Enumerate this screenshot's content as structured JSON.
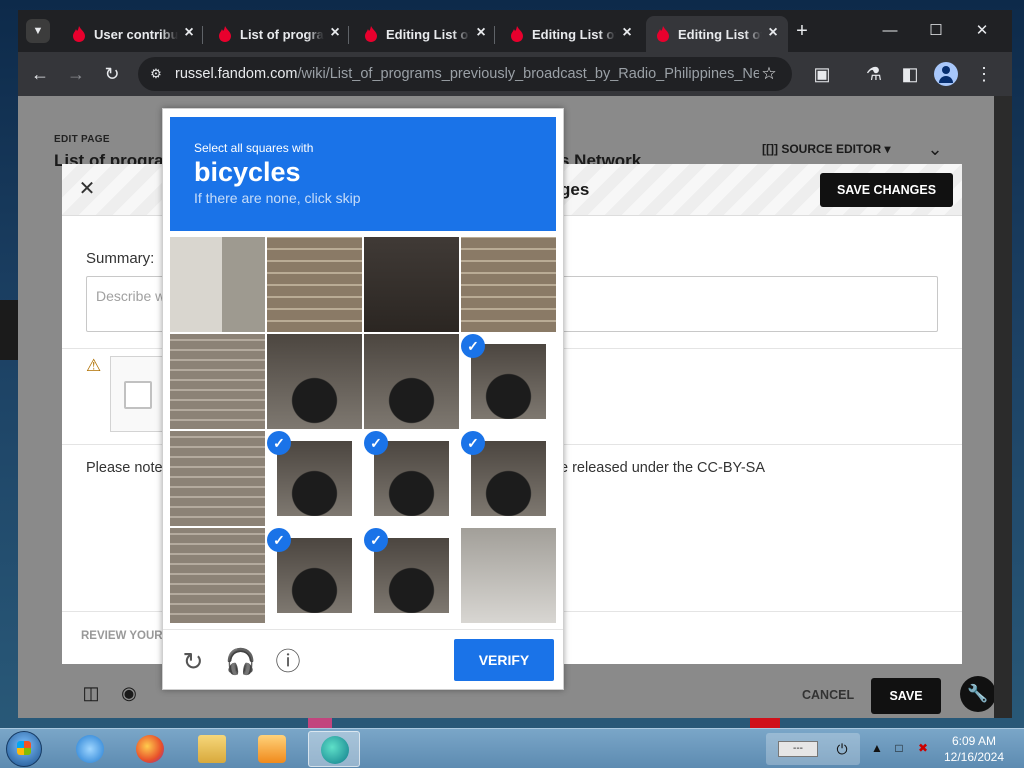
{
  "browser": {
    "tabs": [
      {
        "label": "User contributions",
        "active": false
      },
      {
        "label": "List of programs",
        "active": false
      },
      {
        "label": "Editing List of",
        "active": false
      },
      {
        "label": "Editing List of",
        "active": false
      },
      {
        "label": "Editing List of",
        "active": true
      }
    ],
    "address": {
      "host": "russel.fandom.com",
      "path": "/wiki/List_of_programs_previously_broadcast_by_Radio_Philippines_Netwo..."
    }
  },
  "editor": {
    "edit_page_label": "EDIT PAGE",
    "page_title_left": "List of progra",
    "page_title_right": "s Network",
    "source_editor": "[[]] SOURCE EDITOR ▾",
    "cancel": "CANCEL",
    "save": "SAVE"
  },
  "save_dialog": {
    "title_tail": "ges",
    "save_changes": "SAVE CHANGES",
    "summary_label": "Summary:",
    "summary_placeholder": "Describe w",
    "note_left": "Please note",
    "note_right": "e released under the CC-BY-SA",
    "review": "REVIEW YOUR"
  },
  "captcha": {
    "line1": "Select all squares with",
    "line2": "bicycles",
    "line3": "If there are none, click skip",
    "verify": "VERIFY",
    "tiles": [
      {
        "kind": "wall",
        "selected": false
      },
      {
        "kind": "brick",
        "selected": false
      },
      {
        "kind": "dark",
        "selected": false
      },
      {
        "kind": "brick",
        "selected": false
      },
      {
        "kind": "pillar",
        "selected": false
      },
      {
        "kind": "bike",
        "selected": false
      },
      {
        "kind": "bike",
        "selected": false
      },
      {
        "kind": "bike",
        "selected": true
      },
      {
        "kind": "pillar",
        "selected": false
      },
      {
        "kind": "bike",
        "selected": true
      },
      {
        "kind": "bike",
        "selected": true
      },
      {
        "kind": "bike",
        "selected": true
      },
      {
        "kind": "pillar",
        "selected": false
      },
      {
        "kind": "bike",
        "selected": true
      },
      {
        "kind": "bike",
        "selected": true
      },
      {
        "kind": "ground",
        "selected": false
      }
    ]
  },
  "taskbar": {
    "keyboard": "---",
    "time": "6:09 AM",
    "date": "12/16/2024"
  },
  "colors": {
    "captcha_blue": "#1a73e8",
    "fandom_red": "#e8002d"
  }
}
